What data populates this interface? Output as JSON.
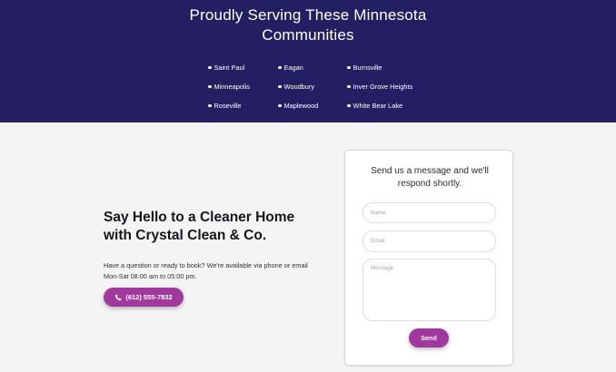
{
  "communities": {
    "title_line1": "Proudly Serving These Minnesota",
    "title_line2": "Communities",
    "towns": [
      "Saint Paul",
      "Eagan",
      "Burnsville",
      "Minneapolis",
      "Woodbury",
      "Inver Grove Heights",
      "Roseville",
      "Maplewood",
      "White Bear Lake"
    ]
  },
  "contact": {
    "heading_line1": "Say Hello to a Cleaner Home",
    "heading_line2": "with Crystal Clean & Co.",
    "body_line1": "Have a question or ready to book? We're available via phone or email",
    "body_line2": "Mon-Sat 08:00 am to 05:00 pm.",
    "phone_label": "(612) 555-7832",
    "phone_icon": "phone-icon"
  },
  "form": {
    "title_line1": "Send us a message and we'll",
    "title_line2": "respond shortly.",
    "name_placeholder": "Name",
    "email_placeholder": "Email",
    "message_placeholder": "Message",
    "send_label": "Send"
  },
  "colors": {
    "band_bg": "#241f62",
    "accent": "#a1389e",
    "section_bg": "#f5f4f5"
  }
}
